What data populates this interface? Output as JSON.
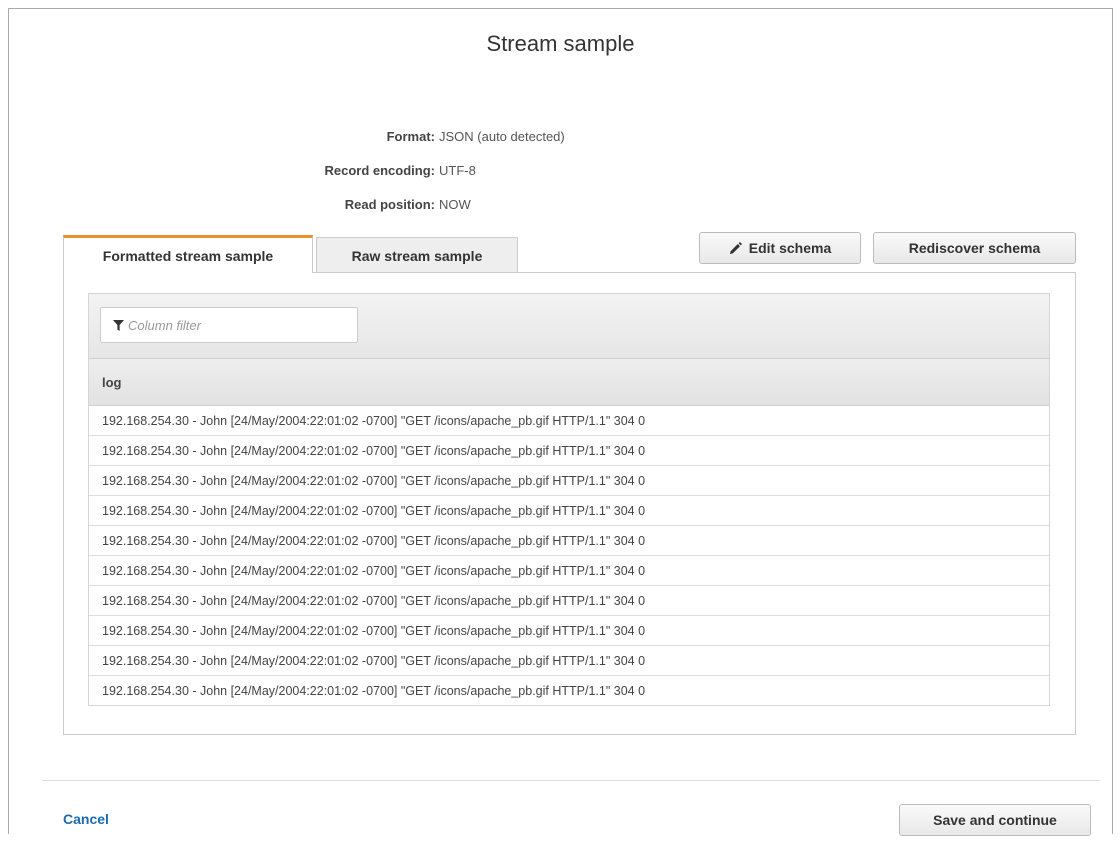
{
  "dialog": {
    "title": "Stream sample"
  },
  "meta": [
    {
      "label": "Format:",
      "value": "JSON (auto detected)"
    },
    {
      "label": "Record encoding:",
      "value": "UTF-8"
    },
    {
      "label": "Read position:",
      "value": "NOW"
    }
  ],
  "tabs": [
    {
      "label": "Formatted stream sample",
      "active": true
    },
    {
      "label": "Raw stream sample",
      "active": false
    }
  ],
  "toolbar": {
    "edit_schema_label": "Edit schema",
    "edit_schema_icon": "pencil-icon",
    "rediscover_schema_label": "Rediscover schema"
  },
  "grid": {
    "filter_placeholder": "Column filter",
    "filter_icon": "funnel-icon",
    "column_header": "log",
    "rows": [
      "192.168.254.30 - John [24/May/2004:22:01:02 -0700] \"GET /icons/apache_pb.gif HTTP/1.1\" 304 0",
      "192.168.254.30 - John [24/May/2004:22:01:02 -0700] \"GET /icons/apache_pb.gif HTTP/1.1\" 304 0",
      "192.168.254.30 - John [24/May/2004:22:01:02 -0700] \"GET /icons/apache_pb.gif HTTP/1.1\" 304 0",
      "192.168.254.30 - John [24/May/2004:22:01:02 -0700] \"GET /icons/apache_pb.gif HTTP/1.1\" 304 0",
      "192.168.254.30 - John [24/May/2004:22:01:02 -0700] \"GET /icons/apache_pb.gif HTTP/1.1\" 304 0",
      "192.168.254.30 - John [24/May/2004:22:01:02 -0700] \"GET /icons/apache_pb.gif HTTP/1.1\" 304 0",
      "192.168.254.30 - John [24/May/2004:22:01:02 -0700] \"GET /icons/apache_pb.gif HTTP/1.1\" 304 0",
      "192.168.254.30 - John [24/May/2004:22:01:02 -0700] \"GET /icons/apache_pb.gif HTTP/1.1\" 304 0",
      "192.168.254.30 - John [24/May/2004:22:01:02 -0700] \"GET /icons/apache_pb.gif HTTP/1.1\" 304 0",
      "192.168.254.30 - John [24/May/2004:22:01:02 -0700] \"GET /icons/apache_pb.gif HTTP/1.1\" 304 0"
    ]
  },
  "footer": {
    "cancel_label": "Cancel",
    "save_label": "Save and continue"
  },
  "colors": {
    "active_tab_accent": "#e8912d",
    "link": "#1a6bb5"
  }
}
